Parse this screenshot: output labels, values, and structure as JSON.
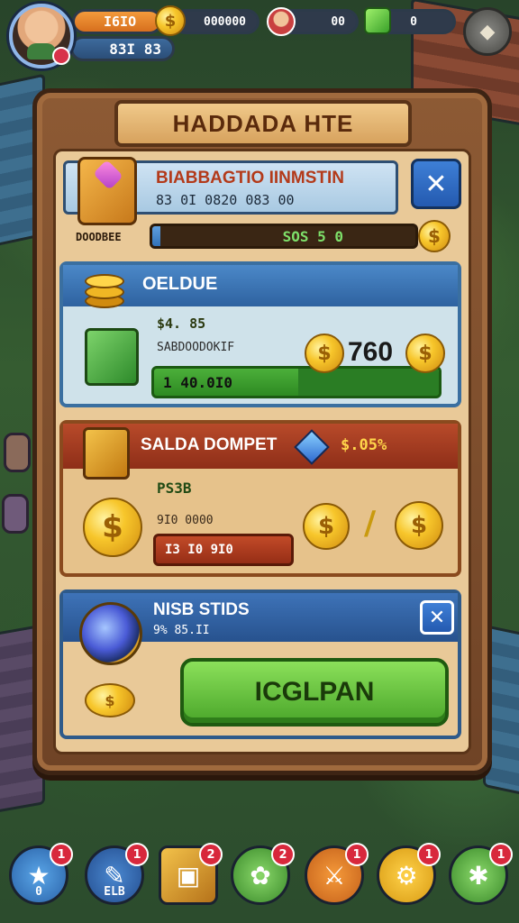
{
  "hud": {
    "player_name": "I6IO",
    "player_level": "83I 83",
    "gold": "000000",
    "gems": "00",
    "energy": "0",
    "currency_symbol": "$"
  },
  "dialog": {
    "title": "HADDADA HTE"
  },
  "offer1": {
    "title": "BIABBAGTIO IINMSTIN",
    "subtitle": "83 0I 0820 083 00",
    "chest_label": "DOODBEE",
    "progress_text": "SOS 5 0",
    "progress_fraction": 0.03,
    "close_label": "✕"
  },
  "offer2": {
    "title": "OELDUE",
    "price": "$4. 85",
    "description": "SABDOODOKIF",
    "bar_text": "1 40.0I0",
    "amount": "760",
    "coin_symbol": "$"
  },
  "offer3": {
    "title": "SALDA DOMPET",
    "discount": "$.05%",
    "code": "PS3B",
    "subtitle": "9I0 0000",
    "bar_text": "I3 I0 9I0",
    "separator": "/",
    "coin_symbol": "$"
  },
  "offer4": {
    "title": "NISB STIDS",
    "subtitle": "9% 85.II",
    "button_label": "ICGLPAN",
    "close_label": "✕",
    "coin_symbol": "$"
  },
  "nav": {
    "items": [
      {
        "icon": "★",
        "badge": "1",
        "sub": "0"
      },
      {
        "icon": "✎",
        "badge": "1",
        "sub": "ELB"
      },
      {
        "icon": "▣",
        "badge": "2",
        "sub": ""
      },
      {
        "icon": "✿",
        "badge": "2",
        "sub": ""
      },
      {
        "icon": "⚔",
        "badge": "1",
        "sub": ""
      },
      {
        "icon": "⚙",
        "badge": "1",
        "sub": ""
      },
      {
        "icon": "✱",
        "badge": "1",
        "sub": ""
      }
    ]
  },
  "colors": {
    "wood": "#8d5a34",
    "panel_blue": "#2e62a0",
    "panel_red": "#8e2e18",
    "accent_green": "#4aa62a",
    "gold": "#f7c62b"
  }
}
